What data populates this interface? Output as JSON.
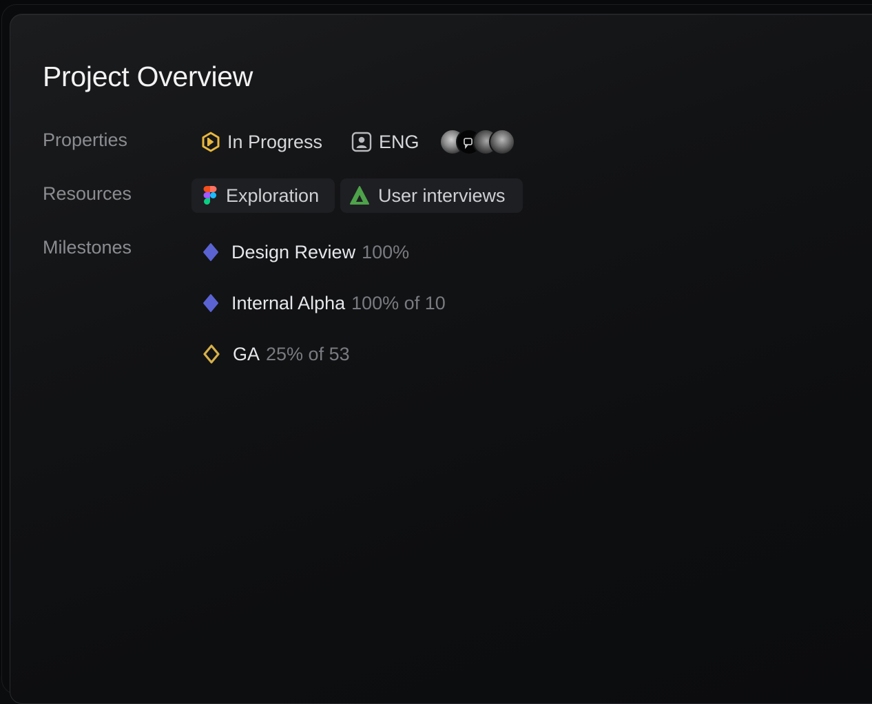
{
  "page_title": "Project Overview",
  "labels": {
    "properties": "Properties",
    "resources": "Resources",
    "milestones": "Milestones"
  },
  "properties": {
    "status": {
      "label": "In Progress",
      "icon": "in-progress-hexagon-icon",
      "color": "#e8b73d"
    },
    "team": {
      "label": "ENG",
      "icon": "team-icon"
    },
    "members": [
      {
        "name": "member-1"
      },
      {
        "name": "member-2"
      },
      {
        "name": "member-3"
      },
      {
        "name": "member-4"
      }
    ]
  },
  "resources": [
    {
      "label": "Exploration",
      "icon": "figma-icon"
    },
    {
      "label": "User interviews",
      "icon": "triangle-doc-icon",
      "color": "#4ea24a"
    }
  ],
  "milestones": [
    {
      "name": "Design Review",
      "meta": "100%",
      "icon": "diamond-filled-icon",
      "color": "#5b63d3",
      "progress": 1.0
    },
    {
      "name": "Internal Alpha",
      "meta": "100% of 10",
      "icon": "diamond-filled-icon",
      "color": "#5b63d3",
      "progress": 1.0
    },
    {
      "name": "GA",
      "meta": "25% of 53",
      "icon": "diamond-outline-icon",
      "color": "#d6b04a",
      "progress": 0.25
    }
  ]
}
